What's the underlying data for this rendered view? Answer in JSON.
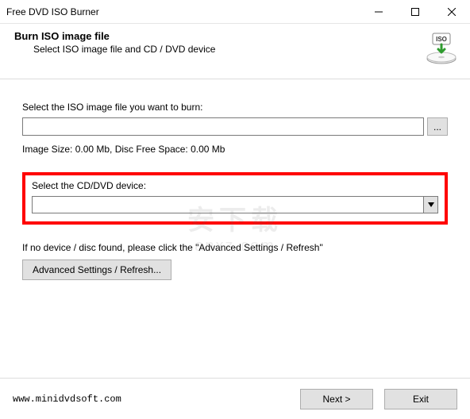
{
  "window": {
    "title": "Free DVD ISO Burner"
  },
  "header": {
    "heading": "Burn ISO image file",
    "subheading": "Select ISO image file and CD / DVD device"
  },
  "file": {
    "label": "Select the ISO image file you want to burn:",
    "value": "",
    "browse_label": "..."
  },
  "size_info": "Image Size: 0.00 Mb, Disc Free Space: 0.00 Mb",
  "device": {
    "label": "Select the CD/DVD device:",
    "value": ""
  },
  "no_device_text": "If no device / disc found, please click the \"Advanced Settings / Refresh\"",
  "advanced_label": "Advanced Settings / Refresh...",
  "footer": {
    "url": "www.minidvdsoft.com",
    "next_label": "Next >",
    "exit_label": "Exit"
  },
  "watermark": {
    "cn": "安下载",
    "en": "anxz.com"
  }
}
